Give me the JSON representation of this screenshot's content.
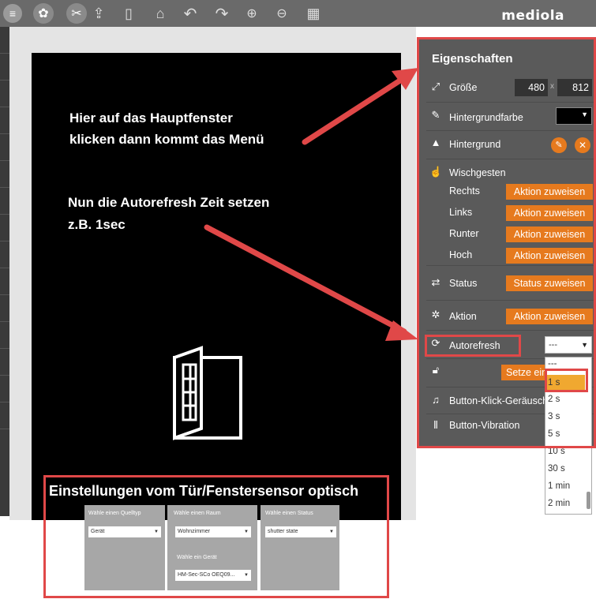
{
  "toolbar": {
    "logo": "mediola",
    "icons": [
      "menu-icon",
      "settings-icon",
      "tools-icon",
      "upload-icon",
      "phone-icon",
      "home-icon",
      "undo-icon",
      "redo-icon",
      "zoom-in-icon",
      "zoom-out-icon",
      "grid-icon"
    ]
  },
  "annotations": {
    "line1": "Hier auf das Hauptfenster",
    "line2": "klicken dann kommt das Menü",
    "line3": "Nun die Autorefresh  Zeit setzen",
    "line4": "z.B. 1sec",
    "caption": "Einstellungen vom Tür/Fenstersensor optisch"
  },
  "panel": {
    "title": "Eigenschaften",
    "size_label": "Größe",
    "width": "480",
    "times": "x",
    "height": "812",
    "bgcolor_label": "Hintergrundfarbe",
    "background_label": "Hintergrund",
    "swipe_label": "Wischgesten",
    "swipe": [
      {
        "label": "Rechts",
        "button": "Aktion zuweisen"
      },
      {
        "label": "Links",
        "button": "Aktion zuweisen"
      },
      {
        "label": "Runter",
        "button": "Aktion zuweisen"
      },
      {
        "label": "Hoch",
        "button": "Aktion zuweisen"
      }
    ],
    "status_label": "Status",
    "status_button": "Status zuweisen",
    "action_label": "Aktion",
    "action_button": "Aktion zuweisen",
    "autorefresh_label": "Autorefresh",
    "autorefresh_value": "---",
    "lock_button": "Setze ein",
    "click_sound_label": "Button-Klick-Geräusch",
    "vibration_label": "Button-Vibration"
  },
  "dropdown": {
    "options": [
      "---",
      "1 s",
      "2 s",
      "3 s",
      "5 s",
      "10 s",
      "30 s",
      "1 min",
      "2 min"
    ],
    "highlighted": "1 s"
  },
  "sensor": {
    "source_label": "Wähle einen Quelltyp",
    "source_value": "Gerät",
    "room_label": "Wähle einen Raum",
    "room_value": "Wohnzimmer",
    "device_label": "Wähle ein Gerät",
    "device_value": "HM-Sec-SCo OEQ09...",
    "status_label": "Wähle einen Status",
    "status_value": "shutter state"
  },
  "colors": {
    "accent": "#e67a1e",
    "highlight": "#e04848",
    "panel": "#5a5a5a"
  }
}
